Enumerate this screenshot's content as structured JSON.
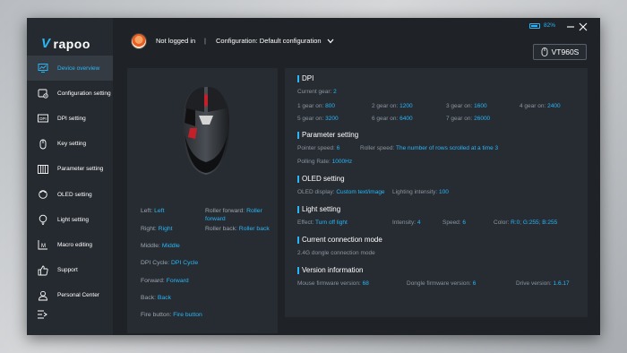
{
  "app": {
    "logo_text": "rapoo",
    "battery_text": "82%",
    "battery_fraction": 0.82,
    "accent": "#29b6f6"
  },
  "sidebar": {
    "items": [
      {
        "label": "Device overview",
        "icon": "monitor-chart-icon"
      },
      {
        "label": "Configuration setting",
        "icon": "gear-config-icon"
      },
      {
        "label": "DPI setting",
        "icon": "dpi-icon"
      },
      {
        "label": "Key setting",
        "icon": "mouse-icon"
      },
      {
        "label": "Parameter setting",
        "icon": "sliders-icon"
      },
      {
        "label": "OLED setting",
        "icon": "oled-icon"
      },
      {
        "label": "Light setting",
        "icon": "bulb-icon"
      },
      {
        "label": "Macro editing",
        "icon": "macro-icon"
      },
      {
        "label": "Support",
        "icon": "thumbs-up-icon"
      },
      {
        "label": "Personal Center",
        "icon": "person-icon"
      }
    ]
  },
  "header": {
    "login_status": "Not logged in",
    "separator": "|",
    "configuration": "Configuration: Default configuration",
    "device_model": "VT960S"
  },
  "buttons_map": {
    "left": {
      "label": "Left:",
      "value": "Left"
    },
    "right": {
      "label": "Right:",
      "value": "Right"
    },
    "middle": {
      "label": "Middle:",
      "value": "Middle"
    },
    "dpi_cycle": {
      "label": "DPI Cycle:",
      "value": "DPI Cycle"
    },
    "forward": {
      "label": "Forward:",
      "value": "Forward"
    },
    "back": {
      "label": "Back:",
      "value": "Back"
    },
    "fire": {
      "label": "Fire button:",
      "value": "Fire button"
    },
    "roller_forward": {
      "label": "Roller forward:",
      "value": "Roller forward"
    },
    "roller_back": {
      "label": "Roller back:",
      "value": "Roller back"
    }
  },
  "dpi": {
    "title": "DPI",
    "current_label": "Current gear:",
    "current_value": "2",
    "gears": [
      {
        "label": "1 gear on:",
        "value": "800"
      },
      {
        "label": "2 gear on:",
        "value": "1200"
      },
      {
        "label": "3 gear on:",
        "value": "1600"
      },
      {
        "label": "4 gear on:",
        "value": "2400"
      },
      {
        "label": "5 gear on:",
        "value": "3200"
      },
      {
        "label": "6 gear on:",
        "value": "6400"
      },
      {
        "label": "7 gear on:",
        "value": "26000"
      }
    ]
  },
  "parameter": {
    "title": "Parameter setting",
    "pointer_label": "Pointer speed:",
    "pointer_value": "6",
    "roller_label": "Roller speed:",
    "roller_value": "The number of rows scrolled at a time 3",
    "polling_label": "Polling Rate:",
    "polling_value": "1000Hz"
  },
  "oled": {
    "title": "OLED setting",
    "display_label": "OLED display:",
    "display_value": "Custom text/image",
    "intensity_label": "Lighting intensity:",
    "intensity_value": "100"
  },
  "light": {
    "title": "Light setting",
    "effect_label": "Effect:",
    "effect_value": "Turn off light",
    "intensity_label": "Intensity:",
    "intensity_value": "4",
    "speed_label": "Speed:",
    "speed_value": "6",
    "color_label": "Color:",
    "color_value": "R:0; G:255; B:255"
  },
  "connection": {
    "title": "Current connection mode",
    "value": "2.4G dongle connection mode"
  },
  "version": {
    "title": "Version information",
    "mouse_label": "Mouse firmware version:",
    "mouse_value": "68",
    "dongle_label": "Dongle firmware version:",
    "dongle_value": "6",
    "drive_label": "Drive version:",
    "drive_value": "1.6.17"
  }
}
